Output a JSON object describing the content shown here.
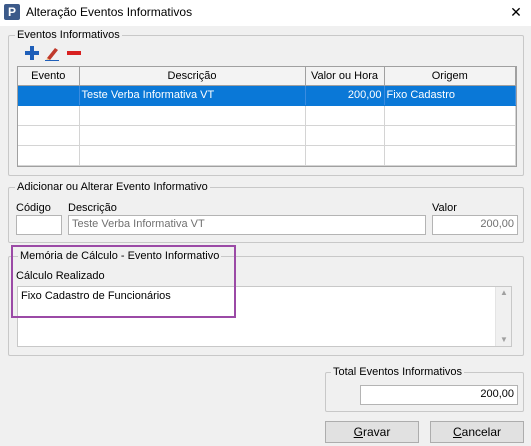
{
  "window": {
    "title": "Alteração Eventos Informativos",
    "close_glyph": "✕",
    "app_icon_letter": "P"
  },
  "eventos_group": {
    "legend": "Eventos Informativos",
    "toolbar": [
      "plus-icon",
      "pencil-icon",
      "minus-icon"
    ],
    "columns": [
      "Evento",
      "Descrição",
      "Valor ou Hora",
      "Origem"
    ],
    "rows": [
      {
        "evento": "",
        "descricao": "Teste Verba Informativa VT",
        "valor": "200,00",
        "origem": "Fixo Cadastro"
      },
      {
        "evento": "",
        "descricao": "",
        "valor": "",
        "origem": ""
      },
      {
        "evento": "",
        "descricao": "",
        "valor": "",
        "origem": ""
      },
      {
        "evento": "",
        "descricao": "",
        "valor": "",
        "origem": ""
      }
    ],
    "selection_color": "#0a78d7"
  },
  "edit_group": {
    "legend": "Adicionar ou Alterar Evento Informativo",
    "codigo_label": "Código",
    "codigo_value": "",
    "descricao_label": "Descrição",
    "descricao_value": "Teste Verba Informativa VT",
    "valor_label": "Valor",
    "valor_value": "200,00"
  },
  "memoria_group": {
    "legend": "Memória de Cálculo - Evento Informativo",
    "calc_label": "Cálculo Realizado",
    "calc_text": "Fixo Cadastro de Funcionários",
    "highlight_color": "#9b4aa6"
  },
  "total_group": {
    "legend": "Total Eventos Informativos",
    "value": "200,00"
  },
  "buttons": {
    "gravar_accel": "G",
    "gravar_rest": "ravar",
    "cancelar_accel": "C",
    "cancelar_rest": "ancelar"
  }
}
